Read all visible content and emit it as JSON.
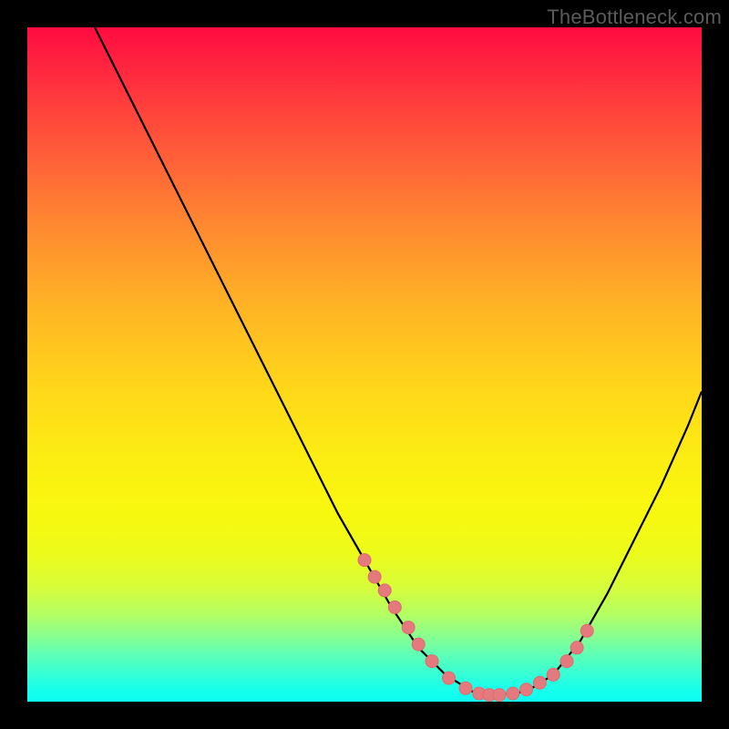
{
  "watermark": "TheBottleneck.com",
  "colors": {
    "curve_stroke": "#000000",
    "marker_fill": "#e47a7e",
    "marker_stroke": "#e06a6e"
  },
  "chart_data": {
    "type": "line",
    "title": "",
    "xlabel": "",
    "ylabel": "",
    "xlim": [
      0,
      100
    ],
    "ylim": [
      0,
      100
    ],
    "grid": false,
    "series": [
      {
        "name": "bottleneck-curve",
        "x": [
          10,
          14,
          18,
          22,
          26,
          30,
          34,
          38,
          42,
          46,
          50,
          54,
          58,
          62,
          66,
          70,
          74,
          78,
          82,
          86,
          90,
          94,
          98,
          100
        ],
        "y": [
          100,
          92,
          84,
          76,
          68,
          60,
          52,
          44,
          36,
          28,
          21,
          14,
          8,
          4,
          1.5,
          1,
          1.5,
          4,
          9,
          16,
          24,
          32,
          41,
          46
        ]
      }
    ],
    "markers": {
      "name": "highlight-points",
      "x": [
        50,
        51.5,
        53,
        54.5,
        56.5,
        58,
        60,
        62.5,
        65,
        67,
        68.5,
        70,
        72,
        74,
        76,
        78,
        80,
        81.5,
        83
      ],
      "y": [
        21,
        18.5,
        16.5,
        14,
        11,
        8.5,
        6,
        3.5,
        2,
        1.2,
        1,
        1,
        1.2,
        1.8,
        2.8,
        4,
        6,
        8,
        10.5
      ]
    }
  }
}
